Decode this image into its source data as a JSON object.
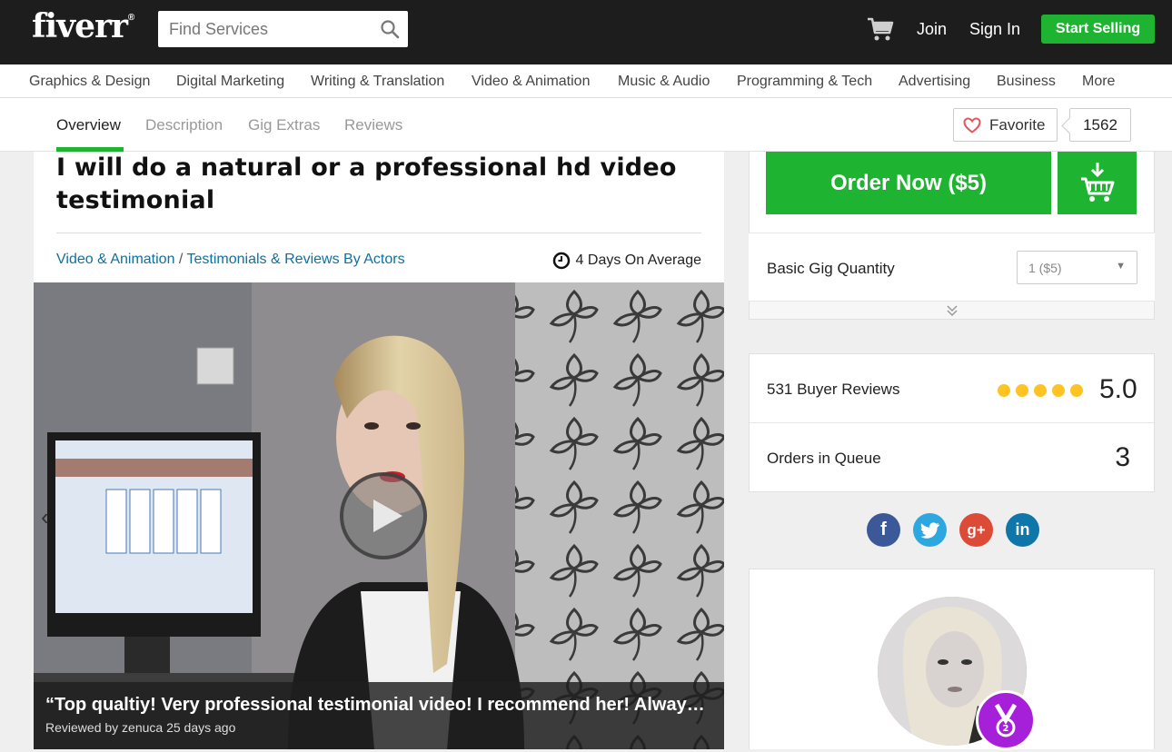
{
  "header": {
    "logo_text": "fiverr",
    "logo_mark": "®",
    "search_placeholder": "Find Services",
    "join_label": "Join",
    "signin_label": "Sign In",
    "start_selling_label": "Start Selling",
    "accent_color": "#1eb431"
  },
  "categories": [
    "Graphics & Design",
    "Digital Marketing",
    "Writing & Translation",
    "Video & Animation",
    "Music & Audio",
    "Programming & Tech",
    "Advertising",
    "Business",
    "More"
  ],
  "tabs": [
    {
      "label": "Overview",
      "active": true
    },
    {
      "label": "Description",
      "active": false
    },
    {
      "label": "Gig Extras",
      "active": false
    },
    {
      "label": "Reviews",
      "active": false
    }
  ],
  "favorite": {
    "label": "Favorite",
    "count": "1562"
  },
  "gig": {
    "title": "I will do a natural or a professional hd video testimonial",
    "breadcrumb": {
      "category": "Video & Animation",
      "separator": " / ",
      "subcategory": "Testimonials & Reviews By Actors"
    },
    "delivery": "4 Days On Average",
    "review": {
      "quote": "“Top qualtiy! Very professional testimonial video! I recommend her! Always…",
      "meta": "Reviewed by zenuca 25 days ago"
    }
  },
  "order": {
    "button_label": "Order Now ($5)",
    "quantity_label": "Basic Gig Quantity",
    "quantity_value": "1 ($5)"
  },
  "stats": {
    "reviews_label": "531 Buyer Reviews",
    "rating": "5.0",
    "stars": 5,
    "queue_label": "Orders in Queue",
    "queue_value": "3"
  },
  "social": {
    "facebook": "f",
    "google": "g+",
    "linkedin": "in"
  }
}
